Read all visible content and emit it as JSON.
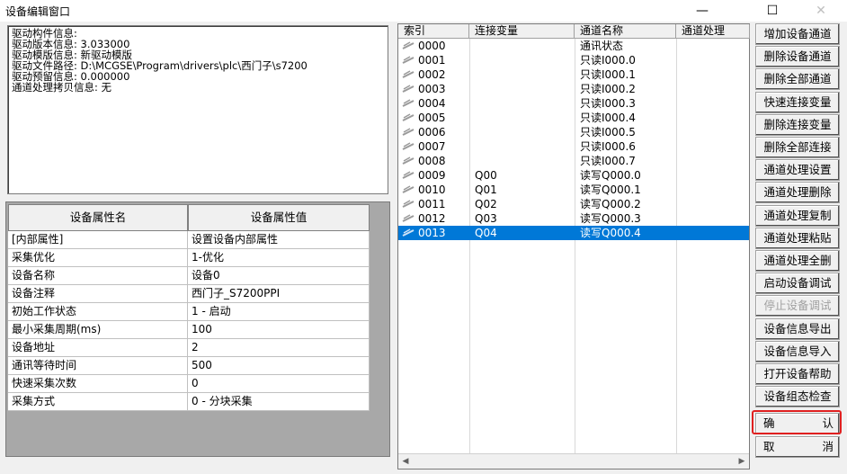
{
  "window": {
    "title": "设备编辑窗口",
    "minimize_glyph": "—",
    "maximize_glyph": "☐",
    "close_glyph": "✕"
  },
  "info_lines": [
    "驱动构件信息:",
    "驱动版本信息: 3.033000",
    "驱动模版信息: 新驱动模版",
    "驱动文件路径: D:\\MCGSE\\Program\\drivers\\plc\\西门子\\s7200",
    "驱动预留信息: 0.000000",
    "通道处理拷贝信息: 无"
  ],
  "properties": {
    "header_name": "设备属性名",
    "header_value": "设备属性值",
    "rows": [
      {
        "name": "[内部属性]",
        "value": "设置设备内部属性"
      },
      {
        "name": "采集优化",
        "value": "1-优化"
      },
      {
        "name": "设备名称",
        "value": "设备0"
      },
      {
        "name": "设备注释",
        "value": "西门子_S7200PPI"
      },
      {
        "name": "初始工作状态",
        "value": "1 - 启动"
      },
      {
        "name": "最小采集周期(ms)",
        "value": "100"
      },
      {
        "name": "设备地址",
        "value": "2"
      },
      {
        "name": "通讯等待时间",
        "value": "500"
      },
      {
        "name": "快速采集次数",
        "value": "0"
      },
      {
        "name": "采集方式",
        "value": "0 - 分块采集"
      }
    ]
  },
  "channels": {
    "headers": [
      "索引",
      "连接变量",
      "通道名称",
      "通道处理"
    ],
    "selected_index": 13,
    "rows": [
      {
        "index": "0000",
        "var": "",
        "name": "通讯状态",
        "proc": ""
      },
      {
        "index": "0001",
        "var": "",
        "name": "只读I000.0",
        "proc": ""
      },
      {
        "index": "0002",
        "var": "",
        "name": "只读I000.1",
        "proc": ""
      },
      {
        "index": "0003",
        "var": "",
        "name": "只读I000.2",
        "proc": ""
      },
      {
        "index": "0004",
        "var": "",
        "name": "只读I000.3",
        "proc": ""
      },
      {
        "index": "0005",
        "var": "",
        "name": "只读I000.4",
        "proc": ""
      },
      {
        "index": "0006",
        "var": "",
        "name": "只读I000.5",
        "proc": ""
      },
      {
        "index": "0007",
        "var": "",
        "name": "只读I000.6",
        "proc": ""
      },
      {
        "index": "0008",
        "var": "",
        "name": "只读I000.7",
        "proc": ""
      },
      {
        "index": "0009",
        "var": "Q00",
        "name": "读写Q000.0",
        "proc": ""
      },
      {
        "index": "0010",
        "var": "Q01",
        "name": "读写Q000.1",
        "proc": ""
      },
      {
        "index": "0011",
        "var": "Q02",
        "name": "读写Q000.2",
        "proc": ""
      },
      {
        "index": "0012",
        "var": "Q03",
        "name": "读写Q000.3",
        "proc": ""
      },
      {
        "index": "0013",
        "var": "Q04",
        "name": "读写Q000.4",
        "proc": ""
      }
    ]
  },
  "buttons": [
    {
      "id": "add-channel",
      "label": "增加设备通道",
      "enabled": true
    },
    {
      "id": "delete-channel",
      "label": "删除设备通道",
      "enabled": true
    },
    {
      "id": "delete-all-channels",
      "label": "删除全部通道",
      "enabled": true
    },
    {
      "id": "quick-connect",
      "label": "快速连接变量",
      "enabled": true
    },
    {
      "id": "delete-connection",
      "label": "删除连接变量",
      "enabled": true
    },
    {
      "id": "delete-all-connections",
      "label": "删除全部连接",
      "enabled": true
    },
    {
      "id": "channel-process-settings",
      "label": "通道处理设置",
      "enabled": true
    },
    {
      "id": "channel-process-delete",
      "label": "通道处理删除",
      "enabled": true
    },
    {
      "id": "channel-process-copy",
      "label": "通道处理复制",
      "enabled": true
    },
    {
      "id": "channel-process-paste",
      "label": "通道处理粘贴",
      "enabled": true
    },
    {
      "id": "channel-process-delete-all",
      "label": "通道处理全删",
      "enabled": true
    },
    {
      "id": "start-device-debug",
      "label": "启动设备调试",
      "enabled": true
    },
    {
      "id": "stop-device-debug",
      "label": "停止设备调试",
      "enabled": false
    },
    {
      "id": "export-device-info",
      "label": "设备信息导出",
      "enabled": true
    },
    {
      "id": "import-device-info",
      "label": "设备信息导入",
      "enabled": true
    },
    {
      "id": "open-device-help",
      "label": "打开设备帮助",
      "enabled": true
    },
    {
      "id": "device-config-check",
      "label": "设备组态检查",
      "enabled": true
    }
  ],
  "confirm_button": {
    "left": "确",
    "right": "认"
  },
  "cancel_button": {
    "left": "取",
    "right": "消"
  },
  "colors": {
    "selection": "#0078d7",
    "highlight_border": "#e02020"
  }
}
